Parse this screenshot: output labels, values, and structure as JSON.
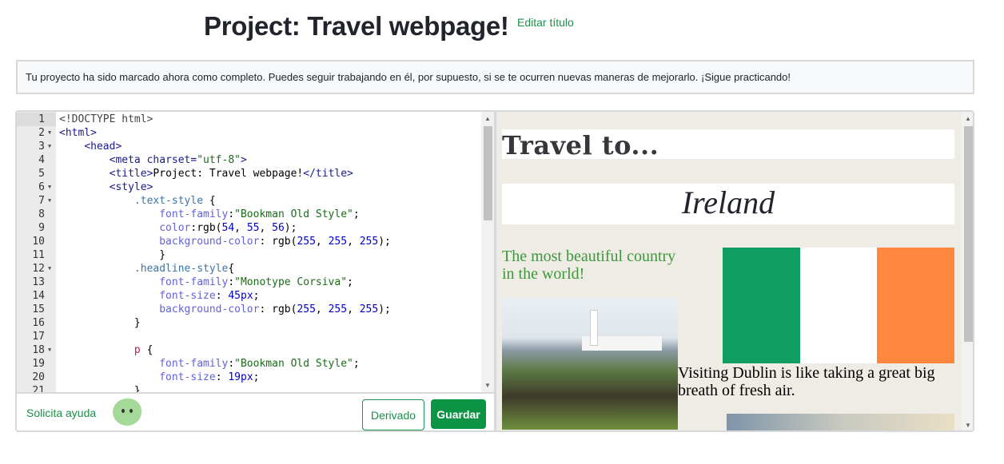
{
  "header": {
    "title": "Project: Travel webpage!",
    "edit_title": "Editar título"
  },
  "notice": "Tu proyecto ha sido marcado ahora como completo. Puedes seguir trabajando en él, por supuesto, si se te ocurren nuevas maneras de mejorarlo. ¡Sigue practicando!",
  "editor": {
    "lines": [
      {
        "n": "1",
        "fold": false,
        "seg": [
          [
            "doc",
            "<!DOCTYPE html>"
          ]
        ]
      },
      {
        "n": "2",
        "fold": true,
        "seg": [
          [
            "tag",
            "<html>"
          ]
        ]
      },
      {
        "n": "3",
        "fold": true,
        "seg": [
          [
            "plain",
            "    "
          ],
          [
            "tag",
            "<head>"
          ]
        ]
      },
      {
        "n": "4",
        "fold": false,
        "seg": [
          [
            "plain",
            "        "
          ],
          [
            "tag",
            "<meta charset="
          ],
          [
            "str",
            "\"utf-8\""
          ],
          [
            "tag",
            ">"
          ]
        ]
      },
      {
        "n": "5",
        "fold": false,
        "seg": [
          [
            "plain",
            "        "
          ],
          [
            "tag",
            "<title>"
          ],
          [
            "plain",
            "Project: Travel webpage!"
          ],
          [
            "tag",
            "</title>"
          ]
        ]
      },
      {
        "n": "6",
        "fold": true,
        "seg": [
          [
            "plain",
            "        "
          ],
          [
            "tag",
            "<style>"
          ]
        ]
      },
      {
        "n": "7",
        "fold": true,
        "seg": [
          [
            "plain",
            "            "
          ],
          [
            "sel",
            ".text-style"
          ],
          [
            "plain",
            " {"
          ]
        ]
      },
      {
        "n": "8",
        "fold": false,
        "seg": [
          [
            "plain",
            "                "
          ],
          [
            "prop",
            "font-family"
          ],
          [
            "plain",
            ":"
          ],
          [
            "str",
            "\"Bookman Old Style\""
          ],
          [
            "plain",
            ";"
          ]
        ]
      },
      {
        "n": "9",
        "fold": false,
        "seg": [
          [
            "plain",
            "                "
          ],
          [
            "prop",
            "color"
          ],
          [
            "plain",
            ":rgb("
          ],
          [
            "num",
            "54"
          ],
          [
            "plain",
            ", "
          ],
          [
            "num",
            "55"
          ],
          [
            "plain",
            ", "
          ],
          [
            "num",
            "56"
          ],
          [
            "plain",
            ");"
          ]
        ]
      },
      {
        "n": "10",
        "fold": false,
        "seg": [
          [
            "plain",
            "                "
          ],
          [
            "prop",
            "background-color"
          ],
          [
            "plain",
            ": rgb("
          ],
          [
            "num",
            "255"
          ],
          [
            "plain",
            ", "
          ],
          [
            "num",
            "255"
          ],
          [
            "plain",
            ", "
          ],
          [
            "num",
            "255"
          ],
          [
            "plain",
            ");"
          ]
        ]
      },
      {
        "n": "11",
        "fold": false,
        "seg": [
          [
            "plain",
            "                }"
          ]
        ]
      },
      {
        "n": "12",
        "fold": true,
        "seg": [
          [
            "plain",
            "            "
          ],
          [
            "sel",
            ".headline-style"
          ],
          [
            "plain",
            "{"
          ]
        ]
      },
      {
        "n": "13",
        "fold": false,
        "seg": [
          [
            "plain",
            "                "
          ],
          [
            "prop",
            "font-family"
          ],
          [
            "plain",
            ":"
          ],
          [
            "str",
            "\"Monotype Corsiva\""
          ],
          [
            "plain",
            ";"
          ]
        ]
      },
      {
        "n": "14",
        "fold": false,
        "seg": [
          [
            "plain",
            "                "
          ],
          [
            "prop",
            "font-size"
          ],
          [
            "plain",
            ": "
          ],
          [
            "num",
            "45px"
          ],
          [
            "plain",
            ";"
          ]
        ]
      },
      {
        "n": "15",
        "fold": false,
        "seg": [
          [
            "plain",
            "                "
          ],
          [
            "prop",
            "background-color"
          ],
          [
            "plain",
            ": rgb("
          ],
          [
            "num",
            "255"
          ],
          [
            "plain",
            ", "
          ],
          [
            "num",
            "255"
          ],
          [
            "plain",
            ", "
          ],
          [
            "num",
            "255"
          ],
          [
            "plain",
            ");"
          ]
        ]
      },
      {
        "n": "16",
        "fold": false,
        "seg": [
          [
            "plain",
            "            }"
          ]
        ]
      },
      {
        "n": "17",
        "fold": false,
        "seg": [
          [
            "plain",
            ""
          ]
        ]
      },
      {
        "n": "18",
        "fold": true,
        "seg": [
          [
            "plain",
            "            "
          ],
          [
            "red",
            "p"
          ],
          [
            "plain",
            " {"
          ]
        ]
      },
      {
        "n": "19",
        "fold": false,
        "seg": [
          [
            "plain",
            "                "
          ],
          [
            "prop",
            "font-family"
          ],
          [
            "plain",
            ":"
          ],
          [
            "str",
            "\"Bookman Old Style\""
          ],
          [
            "plain",
            ";"
          ]
        ]
      },
      {
        "n": "20",
        "fold": false,
        "seg": [
          [
            "plain",
            "                "
          ],
          [
            "prop",
            "font-size"
          ],
          [
            "plain",
            ": "
          ],
          [
            "num",
            "19px"
          ],
          [
            "plain",
            ";"
          ]
        ]
      },
      {
        "n": "21",
        "fold": false,
        "seg": [
          [
            "plain",
            "            }"
          ]
        ]
      }
    ]
  },
  "footer": {
    "help": "Solicita ayuda",
    "derivado": "Derivado",
    "guardar": "Guardar"
  },
  "preview": {
    "heading": "Travel to...",
    "country": "Ireland",
    "subtitle": "The most beautiful country in the world!",
    "paragraph": "Visiting Dublin is like taking a great big breath of fresh air.",
    "flag_colors": [
      "#0f9d62",
      "#ffffff",
      "#ff883e"
    ]
  },
  "colors": {
    "accent": "#0c9444",
    "link": "#1c8f4a"
  }
}
